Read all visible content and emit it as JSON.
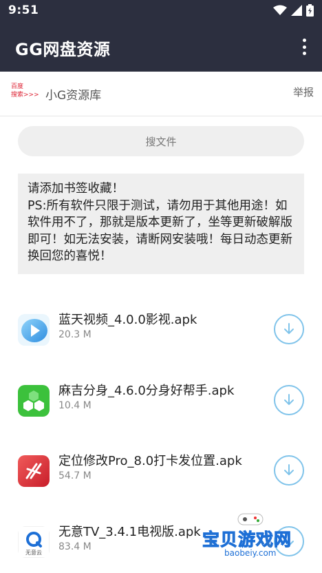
{
  "status_bar": {
    "time": "9:51",
    "icons": [
      "wifi-icon",
      "signal-icon",
      "battery-icon"
    ]
  },
  "app_bar": {
    "title": "GG网盘资源",
    "menu_icon": "more-vert-icon"
  },
  "site_bar": {
    "logo_text_line1": "百度",
    "logo_text_line2": "搜索>>>",
    "site_name": "小G资源库",
    "report_label": "举报"
  },
  "search": {
    "label": "搜文件"
  },
  "notice": {
    "lines": [
      "请添加书签收藏！",
      "PS:所有软件只限于测试，请勿用于其他用途！如软件用不了，那就是版本更新了，坐等更新破解版即可！如无法安装，请断网安装哦！每日动态更新换回您的喜悦！"
    ]
  },
  "files": [
    {
      "name": "蓝天视频_4.0.0影视.apk",
      "size": "20.3 M",
      "icon": "play-app-icon",
      "color": "#5ab8f0"
    },
    {
      "name": "麻吉分身_4.6.0分身好帮手.apk",
      "size": "10.4 M",
      "icon": "hexagon-app-icon",
      "color": "#3cc13c"
    },
    {
      "name": "定位修改Pro_8.0打卡发位置.apk",
      "size": "54.7 M",
      "icon": "location-app-icon",
      "color": "#e43a3a"
    },
    {
      "name": "无意TV_3.4.1电视版.apk",
      "size": "83.4 M",
      "icon": "tv-app-icon",
      "color": "#1d6fd6"
    }
  ],
  "download_icon": "download-icon",
  "accent_color": "#7fc3ea",
  "watermark": {
    "text": "宝贝游戏网",
    "url": "baobeiy.com"
  }
}
